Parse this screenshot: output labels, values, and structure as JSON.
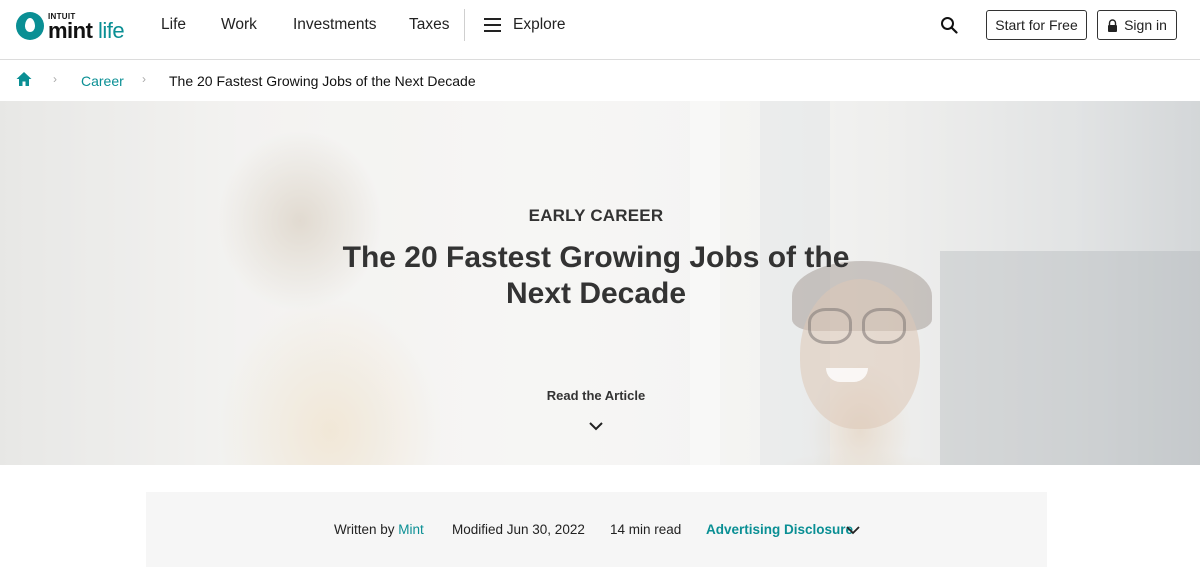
{
  "header": {
    "logo": {
      "brand_small": "INTUIT",
      "brand_mint": "mint",
      "brand_life": "life"
    },
    "nav": [
      {
        "label": "Life"
      },
      {
        "label": "Work"
      },
      {
        "label": "Investments"
      },
      {
        "label": "Taxes"
      }
    ],
    "explore_label": "Explore",
    "start_label": "Start for Free",
    "signin_label": "Sign in",
    "accent_color": "#0a8f94"
  },
  "breadcrumb": {
    "items": [
      {
        "label": "Career"
      }
    ],
    "current": "The 20 Fastest Growing Jobs of the Next Decade"
  },
  "hero": {
    "eyebrow": "EARLY CAREER",
    "title": "The 20 Fastest Growing Jobs of the Next Decade",
    "cta": "Read the Article"
  },
  "meta": {
    "written_by_prefix": "Written by",
    "author": "Mint",
    "modified": "Modified Jun 30, 2022",
    "read_time": "14 min read",
    "disclosure": "Advertising Disclosure"
  }
}
